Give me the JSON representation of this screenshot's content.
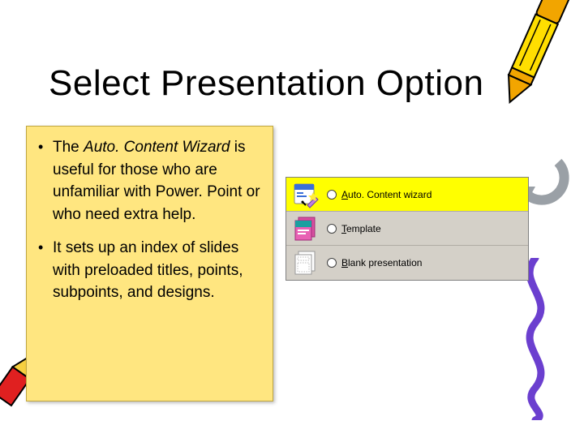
{
  "title": "Select Presentation Option",
  "bullets": [
    {
      "pre": "The ",
      "em": "Auto. Content Wizard",
      "post": " is useful for those who are unfamiliar with Power. Point or who need extra help."
    },
    {
      "pre": "It sets up an index of slides with preloaded titles, points, subpoints, and designs.",
      "em": "",
      "post": ""
    }
  ],
  "options": [
    {
      "label_pre": "",
      "underline": "A",
      "label_post": "uto. Content wizard",
      "selected": true,
      "icon": "wizard"
    },
    {
      "label_pre": "",
      "underline": "T",
      "label_post": "emplate",
      "selected": false,
      "icon": "template"
    },
    {
      "label_pre": "",
      "underline": "B",
      "label_post": "lank presentation",
      "selected": false,
      "icon": "blank"
    }
  ],
  "colors": {
    "content_bg": "#ffe680",
    "option_sel": "#ffff00",
    "panel_bg": "#d4d0c8"
  }
}
